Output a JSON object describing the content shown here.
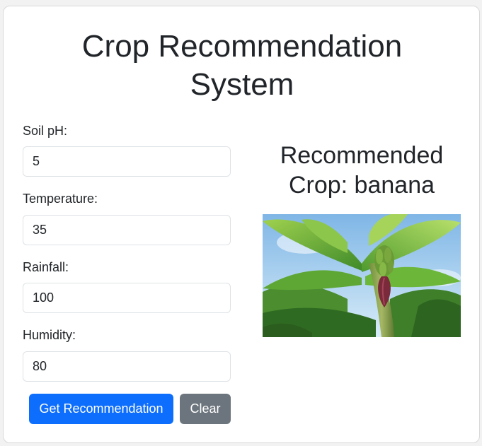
{
  "page": {
    "title_line1": "Crop Recommendation",
    "title_line2": "System"
  },
  "form": {
    "soil_ph": {
      "label": "Soil pH:",
      "value": "5"
    },
    "temperature": {
      "label": "Temperature:",
      "value": "35"
    },
    "rainfall": {
      "label": "Rainfall:",
      "value": "100"
    },
    "humidity": {
      "label": "Humidity:",
      "value": "80"
    },
    "submit_label": "Get Recommendation",
    "clear_label": "Clear"
  },
  "result": {
    "line1": "Recommended",
    "line2": "Crop: banana",
    "image_subject": "banana-plant"
  },
  "colors": {
    "primary": "#0d6efd",
    "secondary": "#6c757d",
    "text": "#212529"
  }
}
